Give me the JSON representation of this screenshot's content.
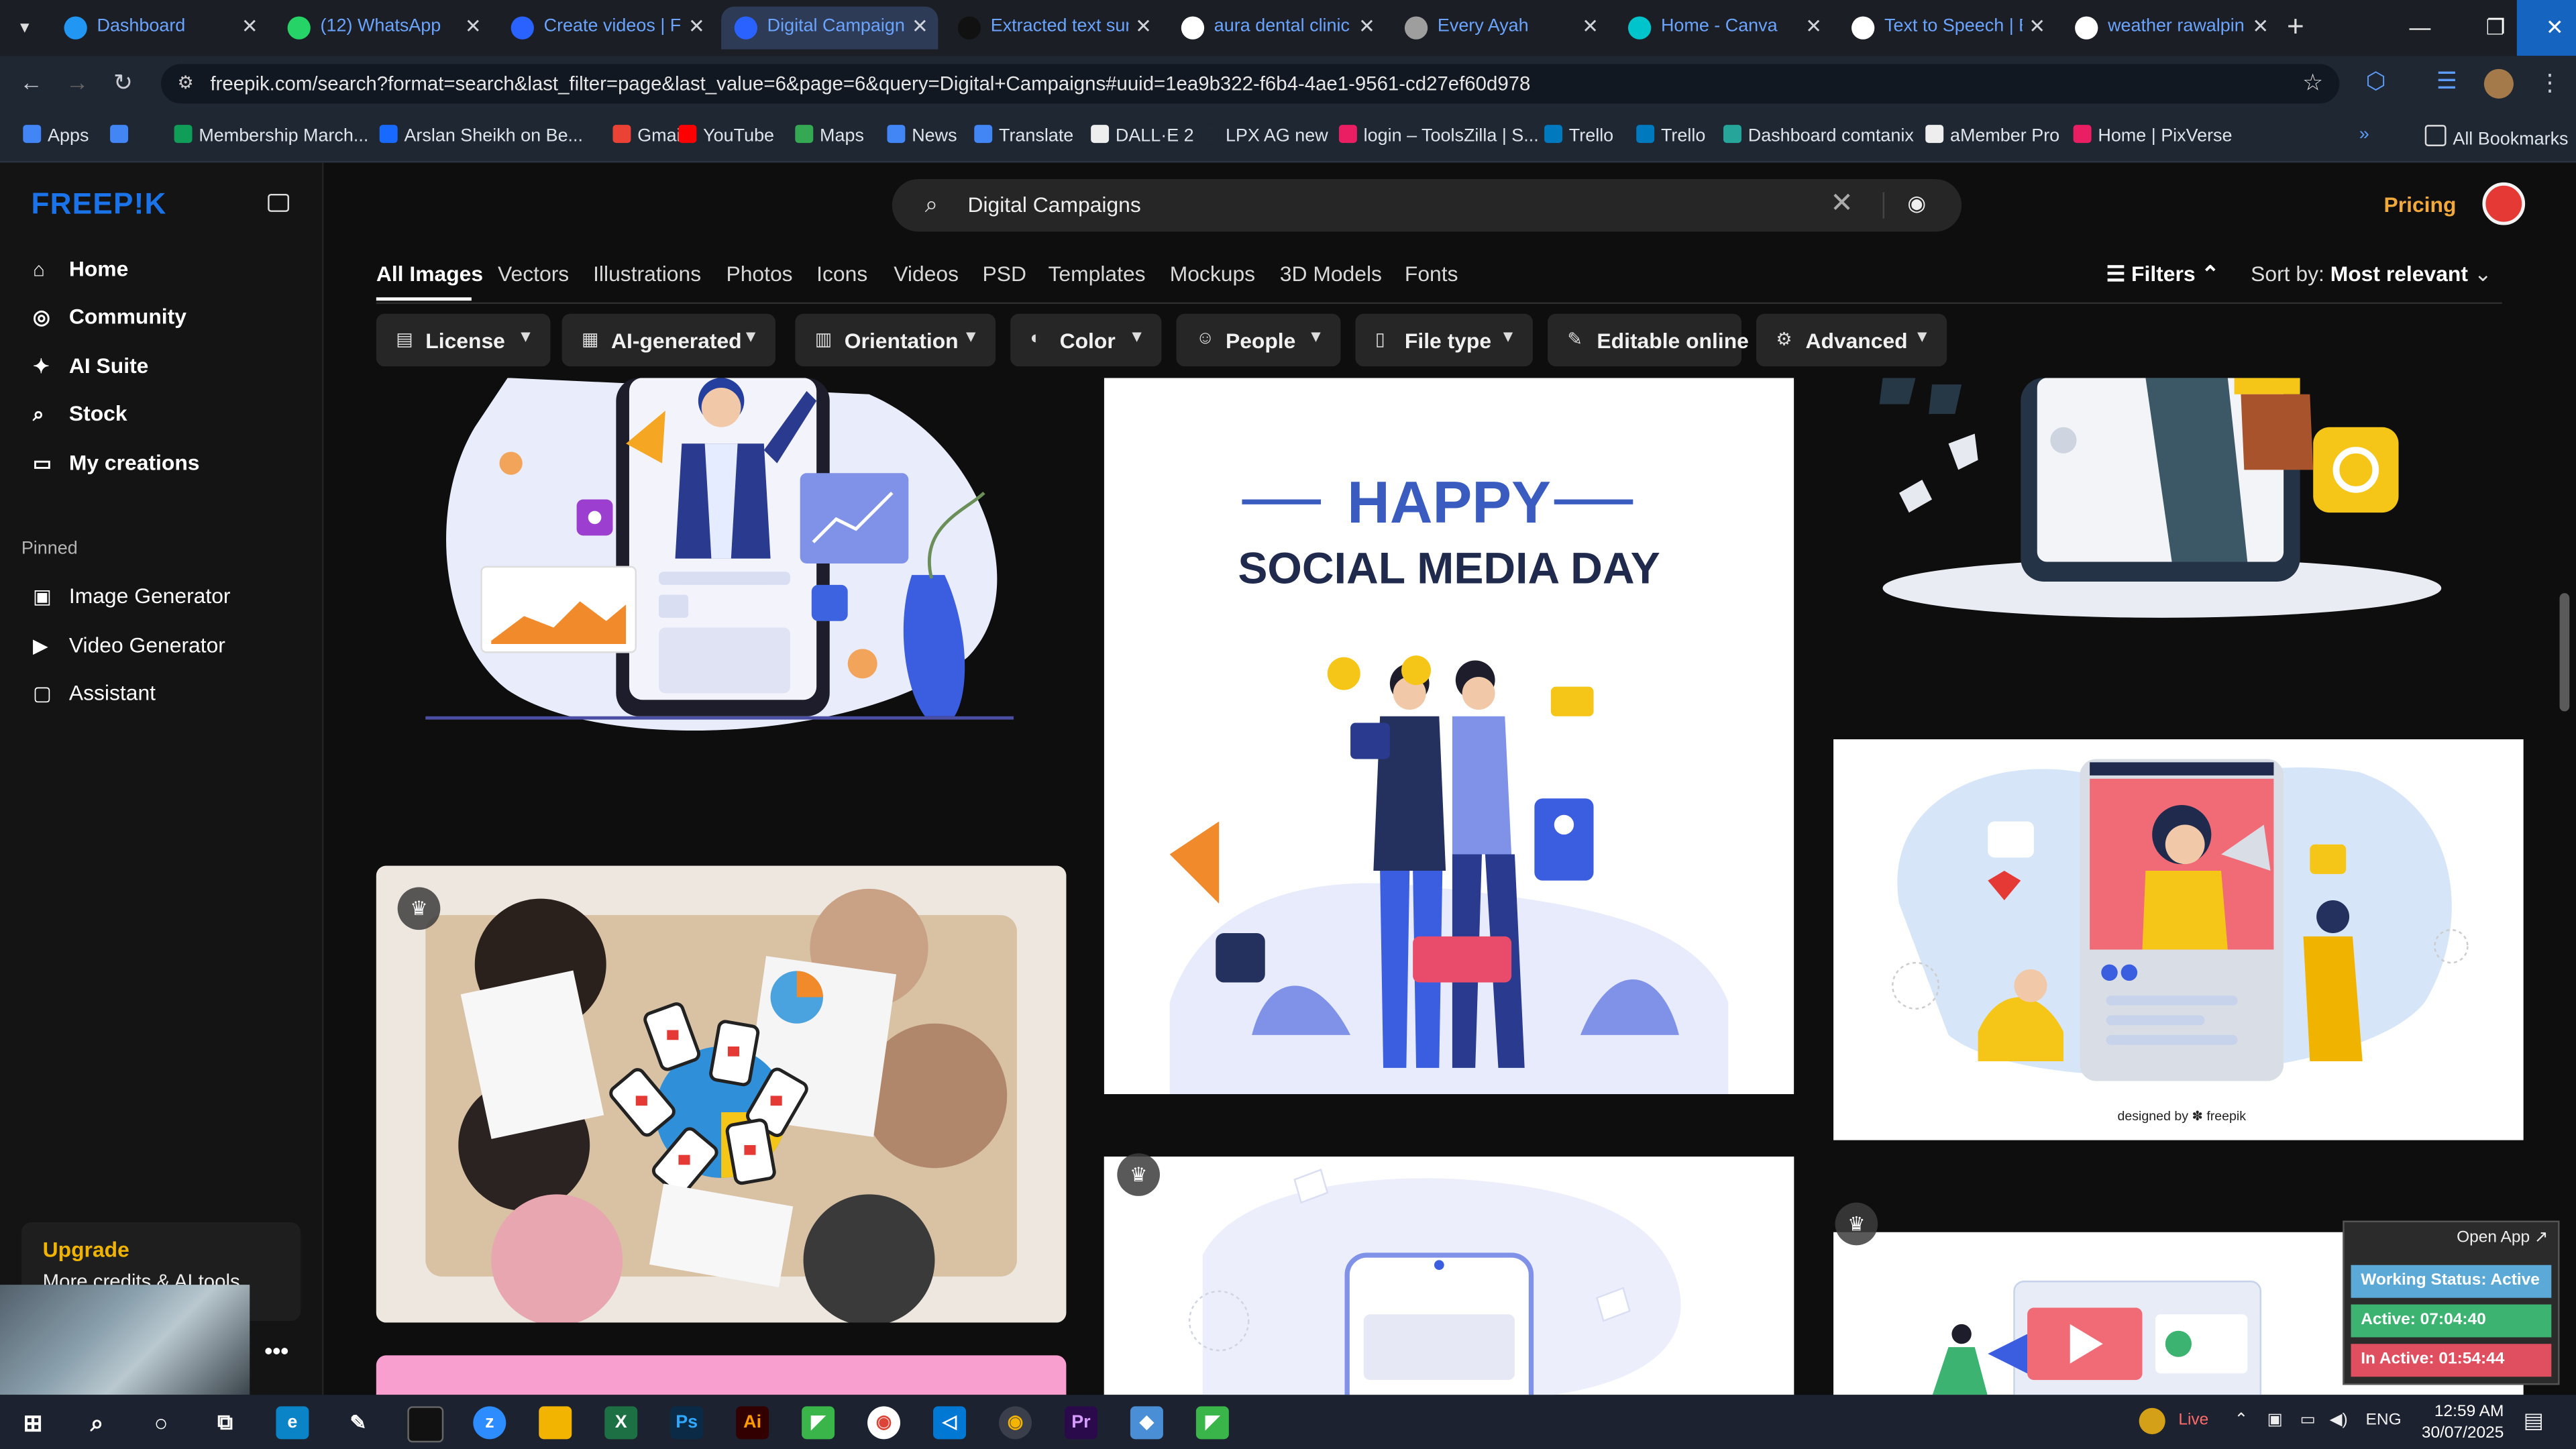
{
  "browser": {
    "tabs": [
      {
        "title": "Dashboard",
        "favicon_color": "#2196f3"
      },
      {
        "title": "(12) WhatsApp",
        "favicon_color": "#25d366"
      },
      {
        "title": "Create videos | Fr",
        "favicon_color": "#2962ff"
      },
      {
        "title": "Digital Campaign",
        "favicon_color": "#2962ff",
        "active": true
      },
      {
        "title": "Extracted text sun",
        "favicon_color": "#111111"
      },
      {
        "title": "aura dental clinic",
        "favicon_color": "#ffffff"
      },
      {
        "title": "Every Ayah",
        "favicon_color": "#9e9e9e"
      },
      {
        "title": "Home - Canva",
        "favicon_color": "#00c4cc"
      },
      {
        "title": "Text to Speech | E",
        "favicon_color": "#ffffff"
      },
      {
        "title": "weather rawalpin",
        "favicon_color": "#ffffff"
      }
    ],
    "url": "freepik.com/search?format=search&last_filter=page&last_value=6&page=6&query=Digital+Campaigns#uuid=1ea9b322-f6b4-4ae1-9561-cd27ef60d978",
    "bookmarks": [
      {
        "label": "Apps",
        "color": "#4285f4"
      },
      {
        "label": "",
        "color": "#4285f4"
      },
      {
        "label": "Membership March...",
        "color": "#0f9d58"
      },
      {
        "label": "Arslan Sheikh on Be...",
        "color": "#1769ff"
      },
      {
        "label": "Gmail",
        "color": "#ea4335"
      },
      {
        "label": "YouTube",
        "color": "#ff0000"
      },
      {
        "label": "Maps",
        "color": "#34a853"
      },
      {
        "label": "News",
        "color": "#4285f4"
      },
      {
        "label": "Translate",
        "color": "#4285f4"
      },
      {
        "label": "DALL·E 2",
        "color": "#eeeeee"
      },
      {
        "label": "LPX AG new",
        "color": "#1f2733"
      },
      {
        "label": "login – ToolsZilla | S...",
        "color": "#e91e63"
      },
      {
        "label": "Trello",
        "color": "#0079bf"
      },
      {
        "label": "Trello",
        "color": "#0079bf"
      },
      {
        "label": "Dashboard comtanix",
        "color": "#26a69a"
      },
      {
        "label": "aMember Pro",
        "color": "#eeeeee"
      },
      {
        "label": "Home | PixVerse",
        "color": "#e91e63"
      }
    ],
    "all_bookmarks": "All Bookmarks"
  },
  "sidebar": {
    "logo": "FREEP!K",
    "nav": [
      {
        "label": "Home",
        "icon": "home-icon",
        "glyph": "⌂"
      },
      {
        "label": "Community",
        "icon": "globe-icon",
        "glyph": "◎"
      },
      {
        "label": "AI Suite",
        "icon": "sparkle-icon",
        "glyph": "✦"
      },
      {
        "label": "Stock",
        "icon": "search-icon",
        "glyph": "⌕"
      },
      {
        "label": "My creations",
        "icon": "folder-icon",
        "glyph": "▭"
      }
    ],
    "pinned_title": "Pinned",
    "pinned": [
      {
        "label": "Image Generator",
        "icon": "image-icon",
        "glyph": "▣"
      },
      {
        "label": "Video Generator",
        "icon": "video-icon",
        "glyph": "▶"
      },
      {
        "label": "Assistant",
        "icon": "chat-icon",
        "glyph": "▢"
      }
    ],
    "upgrade": {
      "title": "Upgrade",
      "subtitle": "More credits & AI tools"
    }
  },
  "header": {
    "search_value": "Digital Campaigns",
    "pricing": "Pricing"
  },
  "categories": [
    "All Images",
    "Vectors",
    "Illustrations",
    "Photos",
    "Icons",
    "Videos",
    "PSD",
    "Templates",
    "Mockups",
    "3D Models",
    "Fonts"
  ],
  "filters_label": "Filters",
  "sort": {
    "label": "Sort by:",
    "value": "Most relevant"
  },
  "chips": [
    {
      "label": "License",
      "icon": "license-icon",
      "glyph": "▤"
    },
    {
      "label": "AI-generated",
      "icon": "ai-icon",
      "glyph": "▦"
    },
    {
      "label": "Orientation",
      "icon": "orientation-icon",
      "glyph": "▥"
    },
    {
      "label": "Color",
      "icon": "palette-icon",
      "glyph": "◐"
    },
    {
      "label": "People",
      "icon": "people-icon",
      "glyph": "☺"
    },
    {
      "label": "File type",
      "icon": "file-icon",
      "glyph": "▯"
    },
    {
      "label": "Editable online",
      "icon": "pencil-icon",
      "glyph": "✎"
    },
    {
      "label": "Advanced",
      "icon": "gear-icon",
      "glyph": "⚙"
    }
  ],
  "results": {
    "social_day_title_1": "HAPPY",
    "social_day_title_2": "SOCIAL MEDIA DAY",
    "designed_by": "designed by ✽ freepik"
  },
  "widget": {
    "open_app": "Open App ↗",
    "working_status": "Working Status: Active",
    "active": "Active: 07:04:40",
    "inactive": "In Active: 01:54:44"
  },
  "taskbar": {
    "live": "Live",
    "lang": "ENG",
    "time": "12:59 AM",
    "date": "30/07/2025"
  }
}
